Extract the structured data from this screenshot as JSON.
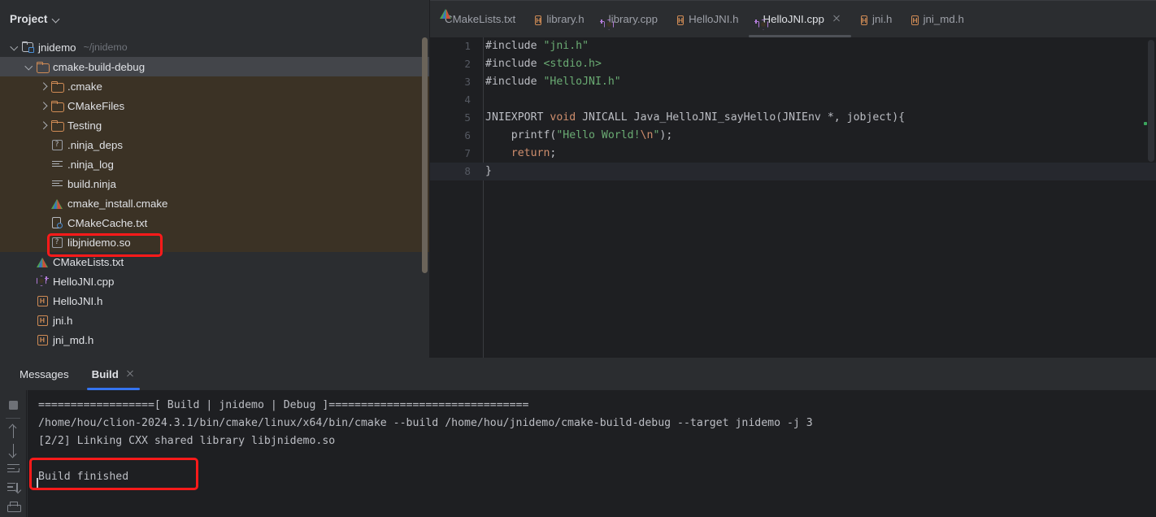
{
  "project_panel": {
    "title": "Project",
    "dropdown_icon": "chevron-down-icon",
    "tree": [
      {
        "label": "jnidemo",
        "sublabel": "~/jnidemo",
        "icon": "module-folder-icon",
        "arrow": "down",
        "indent": 0,
        "state": "normal"
      },
      {
        "label": "cmake-build-debug",
        "sublabel": "",
        "icon": "folder-icon",
        "arrow": "down",
        "indent": 1,
        "state": "selected"
      },
      {
        "label": ".cmake",
        "sublabel": "",
        "icon": "folder-icon",
        "arrow": "right",
        "indent": 2,
        "state": "excluded"
      },
      {
        "label": "CMakeFiles",
        "sublabel": "",
        "icon": "folder-icon",
        "arrow": "right",
        "indent": 2,
        "state": "excluded"
      },
      {
        "label": "Testing",
        "sublabel": "",
        "icon": "folder-icon",
        "arrow": "right",
        "indent": 2,
        "state": "excluded"
      },
      {
        "label": ".ninja_deps",
        "sublabel": "",
        "icon": "unknown-file-icon",
        "arrow": "none",
        "indent": 2,
        "state": "excluded"
      },
      {
        "label": ".ninja_log",
        "sublabel": "",
        "icon": "text-file-icon",
        "arrow": "none",
        "indent": 2,
        "state": "excluded"
      },
      {
        "label": "build.ninja",
        "sublabel": "",
        "icon": "text-file-icon",
        "arrow": "none",
        "indent": 2,
        "state": "excluded"
      },
      {
        "label": "cmake_install.cmake",
        "sublabel": "",
        "icon": "cmake-icon",
        "arrow": "none",
        "indent": 2,
        "state": "excluded"
      },
      {
        "label": "CMakeCache.txt",
        "sublabel": "",
        "icon": "cmake-cache-icon",
        "arrow": "none",
        "indent": 2,
        "state": "excluded"
      },
      {
        "label": "libjnidemo.so",
        "sublabel": "",
        "icon": "unknown-file-icon",
        "arrow": "none",
        "indent": 2,
        "state": "excluded"
      },
      {
        "label": "CMakeLists.txt",
        "sublabel": "",
        "icon": "cmake-icon",
        "arrow": "none",
        "indent": 1,
        "state": "normal"
      },
      {
        "label": "HelloJNI.cpp",
        "sublabel": "",
        "icon": "cpp-file-icon",
        "arrow": "none",
        "indent": 1,
        "state": "normal"
      },
      {
        "label": "HelloJNI.h",
        "sublabel": "",
        "icon": "header-file-icon",
        "arrow": "none",
        "indent": 1,
        "state": "normal"
      },
      {
        "label": "jni.h",
        "sublabel": "",
        "icon": "header-file-icon",
        "arrow": "none",
        "indent": 1,
        "state": "normal"
      },
      {
        "label": "jni_md.h",
        "sublabel": "",
        "icon": "header-file-icon",
        "arrow": "none",
        "indent": 1,
        "state": "normal"
      }
    ]
  },
  "editor": {
    "tabs": [
      {
        "label": "CMakeLists.txt",
        "icon": "cmake-icon",
        "active": false,
        "closable": false
      },
      {
        "label": "library.h",
        "icon": "header-file-icon",
        "active": false,
        "closable": false
      },
      {
        "label": "library.cpp",
        "icon": "cpp-file-icon",
        "active": false,
        "closable": false
      },
      {
        "label": "HelloJNI.h",
        "icon": "header-file-icon",
        "active": false,
        "closable": false
      },
      {
        "label": "HelloJNI.cpp",
        "icon": "cpp-file-icon",
        "active": true,
        "closable": true
      },
      {
        "label": "jni.h",
        "icon": "header-file-icon",
        "active": false,
        "closable": false
      },
      {
        "label": "jni_md.h",
        "icon": "header-file-icon",
        "active": false,
        "closable": false
      }
    ],
    "lines": [
      {
        "n": "1",
        "current": false,
        "tokens": [
          {
            "t": "#include ",
            "c": "pre"
          },
          {
            "t": "\"jni.h\"",
            "c": "str"
          }
        ]
      },
      {
        "n": "2",
        "current": false,
        "tokens": [
          {
            "t": "#include ",
            "c": "pre"
          },
          {
            "t": "<stdio.h>",
            "c": "str"
          }
        ]
      },
      {
        "n": "3",
        "current": false,
        "tokens": [
          {
            "t": "#include ",
            "c": "pre"
          },
          {
            "t": "\"HelloJNI.h\"",
            "c": "str"
          }
        ]
      },
      {
        "n": "4",
        "current": false,
        "tokens": [
          {
            "t": "",
            "c": "id"
          }
        ]
      },
      {
        "n": "5",
        "current": false,
        "tokens": [
          {
            "t": "JNIEXPORT ",
            "c": "id"
          },
          {
            "t": "void",
            "c": "kw"
          },
          {
            "t": " JNICALL Java_HelloJNI_sayHello(JNIEnv *, jobject){",
            "c": "id"
          }
        ]
      },
      {
        "n": "6",
        "current": false,
        "tokens": [
          {
            "t": "    printf(",
            "c": "id"
          },
          {
            "t": "\"Hello World!",
            "c": "str"
          },
          {
            "t": "\\n",
            "c": "esc"
          },
          {
            "t": "\"",
            "c": "str"
          },
          {
            "t": ");",
            "c": "id"
          }
        ]
      },
      {
        "n": "7",
        "current": false,
        "tokens": [
          {
            "t": "    ",
            "c": "id"
          },
          {
            "t": "return",
            "c": "kw"
          },
          {
            "t": ";",
            "c": "id"
          }
        ]
      },
      {
        "n": "8",
        "current": true,
        "tokens": [
          {
            "t": "}",
            "c": "id"
          }
        ]
      }
    ]
  },
  "bottom_panel": {
    "tabs": [
      {
        "label": "Messages",
        "active": false,
        "closable": false
      },
      {
        "label": "Build",
        "active": true,
        "closable": true
      }
    ],
    "toolbar_icons": [
      "stop-icon",
      "arrow-up-icon",
      "arrow-down-icon",
      "soft-wrap-icon",
      "scroll-to-end-icon",
      "print-icon"
    ],
    "console_lines": [
      "==================[ Build | jnidemo | Debug ]===============================",
      "/home/hou/clion-2024.3.1/bin/cmake/linux/x64/bin/cmake --build /home/hou/jnidemo/cmake-build-debug --target jnidemo -j 3",
      "[2/2] Linking CXX shared library libjnidemo.so",
      "",
      "Build finished"
    ]
  },
  "annotations": {
    "highlight_color": "#ff1a1a",
    "boxes": [
      {
        "name": "libjnidemo-so-highlight",
        "target": "libjnidemo.so"
      },
      {
        "name": "build-finished-highlight",
        "target": "Build finished"
      }
    ]
  }
}
